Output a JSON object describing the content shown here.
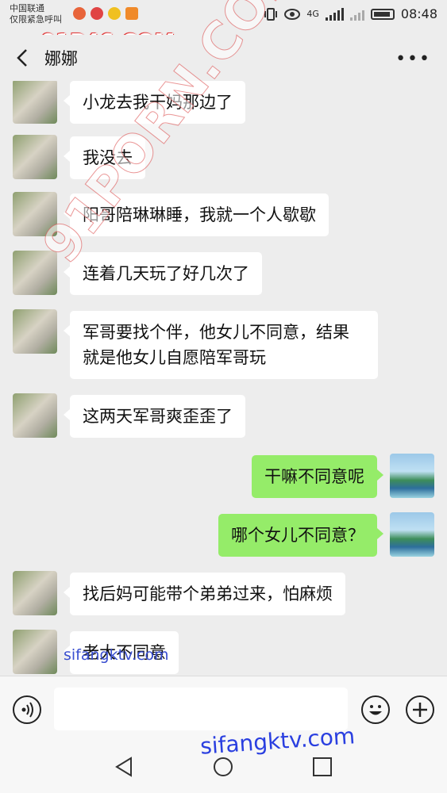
{
  "status_bar": {
    "carrier_line1": "中国联通",
    "carrier_line2": "仅限紧急呼叫",
    "network": "4G",
    "time": "08:48"
  },
  "watermarks": {
    "top": "91P46.COM",
    "diagonal": "91PORN.COM",
    "inline": "sifangktv.com",
    "bottom": "sifangktv.com"
  },
  "header": {
    "title": "娜娜",
    "back_icon": "chevron-left-icon",
    "more_icon": "more-dots-icon"
  },
  "messages": [
    {
      "side": "left",
      "text": "小龙去我干妈那边了"
    },
    {
      "side": "left",
      "text": "我没去"
    },
    {
      "side": "left",
      "text": "阳哥陪琳琳睡，我就一个人歇歇"
    },
    {
      "side": "left",
      "text": "连着几天玩了好几次了"
    },
    {
      "side": "left",
      "text": "军哥要找个伴，他女儿不同意，结果就是他女儿自愿陪军哥玩"
    },
    {
      "side": "left",
      "text": "这两天军哥爽歪歪了"
    },
    {
      "side": "right",
      "text": "干嘛不同意呢"
    },
    {
      "side": "right",
      "text": "哪个女儿不同意？"
    },
    {
      "side": "left",
      "text": "找后妈可能带个弟弟过来，怕麻烦"
    },
    {
      "side": "left",
      "text": "老大不同意"
    }
  ],
  "input_bar": {
    "value": "",
    "voice_icon": "voice-icon",
    "emoji_icon": "emoji-icon",
    "plus_icon": "plus-icon"
  },
  "colors": {
    "background": "#ededed",
    "bubble_left": "#ffffff",
    "bubble_right": "#95ec69",
    "watermark_red": "#e03a3a",
    "watermark_blue": "#2a3fe0"
  }
}
